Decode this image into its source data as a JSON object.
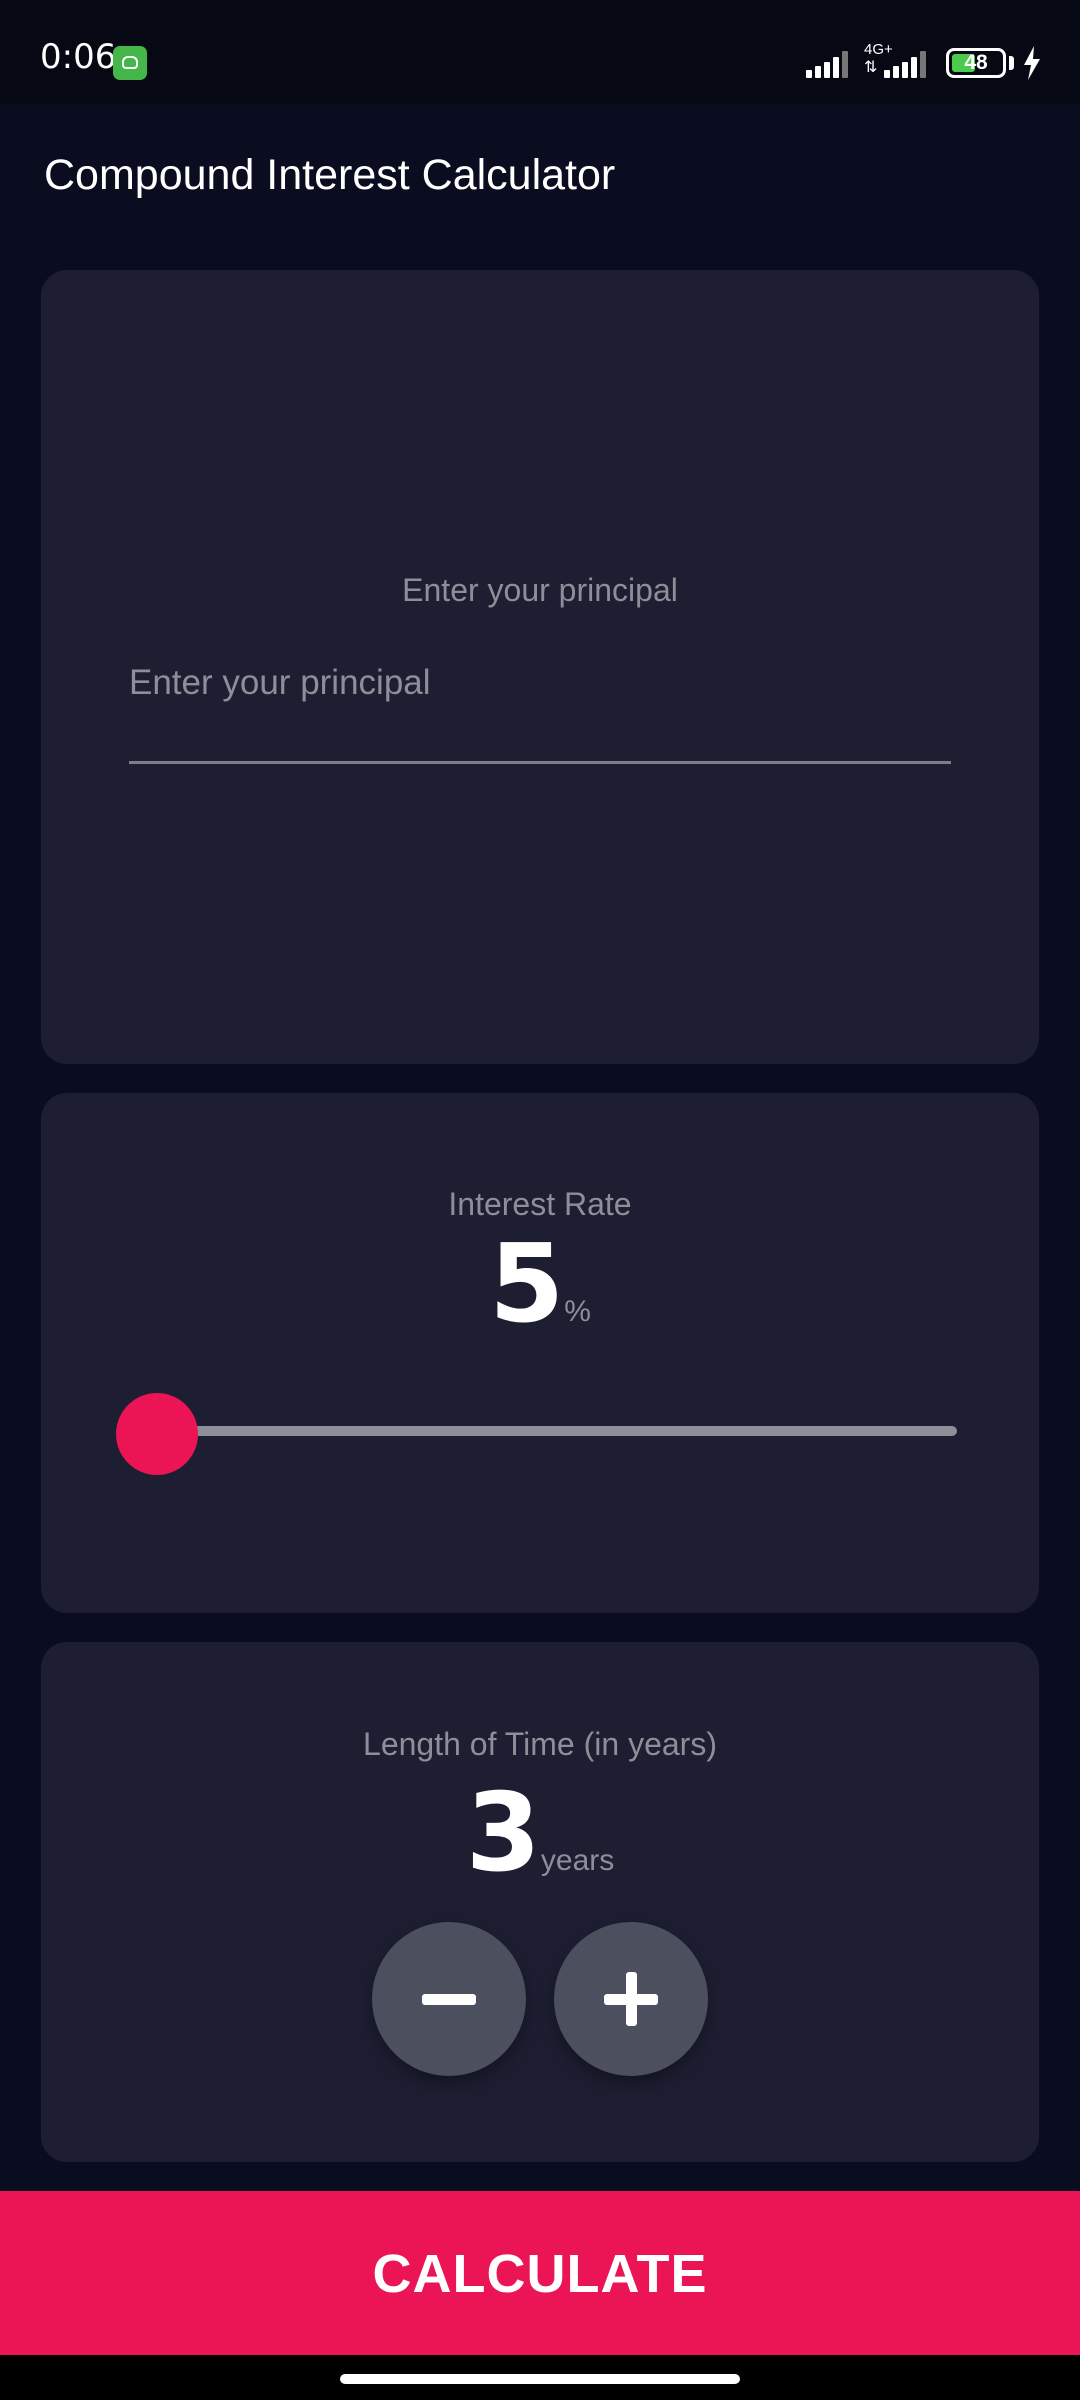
{
  "status_bar": {
    "time": "0:06",
    "network_label": "4G+",
    "battery_level": "48",
    "battery_fraction": 0.48,
    "app_icon": "android-icon",
    "charging_icon": "bolt-icon"
  },
  "app_bar": {
    "title": "Compound Interest Calculator"
  },
  "principal": {
    "label": "Enter your principal",
    "placeholder": "Enter your principal",
    "value": ""
  },
  "interest_rate": {
    "label": "Interest Rate",
    "value": "5",
    "unit": "%",
    "slider_fraction": 0.0
  },
  "length_of_time": {
    "label": "Length of Time (in years)",
    "value": "3",
    "unit": "years",
    "decrement_icon": "minus-icon",
    "increment_icon": "plus-icon"
  },
  "calculate_button": {
    "label": "CALCULATE"
  },
  "colors": {
    "background": "#090d1f",
    "card": "#1d1e32",
    "accent": "#eb1555",
    "muted_text": "#8d8e98",
    "round_button": "#4c4f5e"
  }
}
